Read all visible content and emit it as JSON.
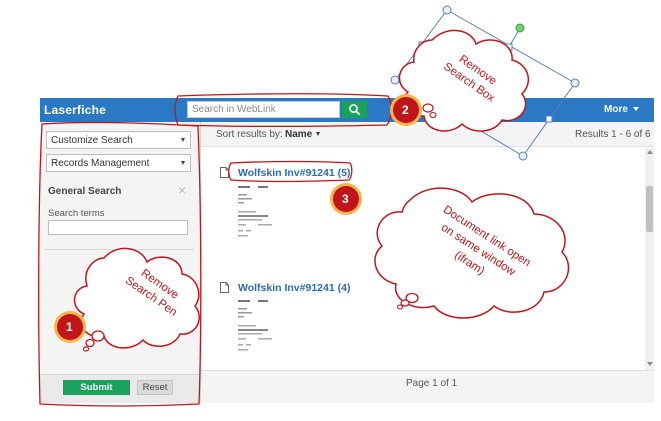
{
  "app": {
    "logo": "Laserfiche",
    "more_label": "More"
  },
  "search": {
    "placeholder": "Search in WebLink"
  },
  "sidebar": {
    "select1": "Customize Search",
    "select2": "Records Management",
    "general_search_title": "General Search",
    "close_glyph": "×",
    "search_terms_label": "Search terms",
    "submit_label": "Submit",
    "reset_label": "Reset"
  },
  "results": {
    "sort_label": "Sort results by:",
    "sort_value": "Name",
    "count": "Results 1 - 6 of 6",
    "items": [
      {
        "title": "Wolfskin Inv#91241 (5)"
      },
      {
        "title": "Wolfskin Inv#91241 (4)"
      }
    ],
    "pager": "Page 1 of 1"
  },
  "annotations": {
    "badges": [
      "1",
      "2",
      "3"
    ],
    "cloud1": [
      "Remove",
      "Search Pen"
    ],
    "cloud2": [
      "Remove",
      "Search Box"
    ],
    "cloud3": [
      "Document link open",
      "on same window",
      "(ifram)"
    ]
  },
  "colors": {
    "topbar": "#2b78c5",
    "green": "#1aa15b",
    "link": "#2b6bb3",
    "annotation_red": "#c0161b",
    "badge_orange": "#f39a1d"
  }
}
